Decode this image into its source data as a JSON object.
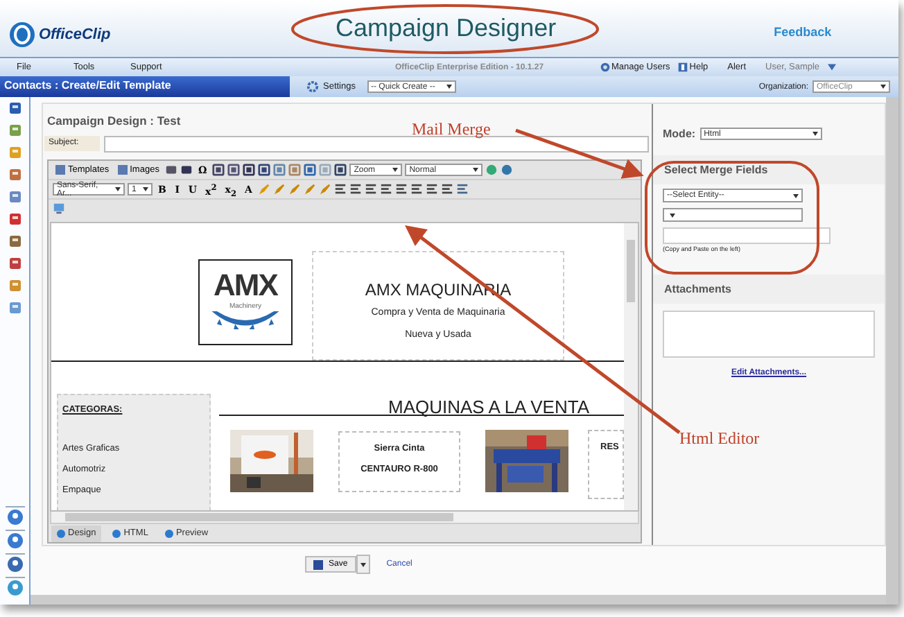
{
  "header": {
    "logo": "OfficeClip",
    "title": "Campaign Designer",
    "feedback": "Feedback"
  },
  "menubar": {
    "menus": [
      "File",
      "Tools",
      "Support"
    ],
    "edition": "OfficeClip Enterprise Edition - 10.1.27",
    "manage_users": "Manage Users",
    "help": "Help",
    "alert": "Alert",
    "user": "User, Sample"
  },
  "toolbar": {
    "page_title": "Contacts : Create/Edit Template",
    "settings": "Settings",
    "quick_create": "-- Quick Create --",
    "organization_label": "Organization:",
    "organization": "OfficeClip"
  },
  "form": {
    "heading": "Campaign Design : Test",
    "subject_label": "Subject:"
  },
  "editor": {
    "buttons": [
      "Templates",
      "Images"
    ],
    "special_char": "Ω",
    "zoom": "Zoom",
    "format": "Normal",
    "font": "Sans-Serif, Ar...",
    "size": "1",
    "styles": [
      "B",
      "I",
      "U",
      "x$^{2}$",
      "x$_{2}$",
      "A"
    ],
    "tabs": [
      {
        "label": "Design",
        "selected": true
      },
      {
        "label": "HTML",
        "selected": false
      },
      {
        "label": "Preview",
        "selected": false
      }
    ]
  },
  "document": {
    "logo": "AMX",
    "logo_sub": "Machinery",
    "company": "AMX MAQUINARIA",
    "tagline": "Compra y Venta de Maquinaria",
    "subtitle": "Nueva y Usada",
    "section": "MAQUINAS A LA VENTA",
    "categories_title": "CATEGORAS:",
    "categories": [
      "Artes Graficas",
      "Automotriz",
      "Empaque"
    ],
    "product_name": "Sierra Cinta",
    "product_model": "CENTAURO R-800",
    "partial": "RES"
  },
  "side_panel": {
    "mode_label": "Mode:",
    "mode": "Html",
    "merge_heading": "Select Merge Fields",
    "entity": "--Select Entity--",
    "hint": "(Copy and Paste on the left)",
    "attachments_heading": "Attachments",
    "edit_attachments": "Edit Attachments..."
  },
  "annotations": {
    "mail_merge": "Mail Merge",
    "html_editor": "Html Editor"
  },
  "actions": {
    "save": "Save",
    "cancel": "Cancel"
  }
}
